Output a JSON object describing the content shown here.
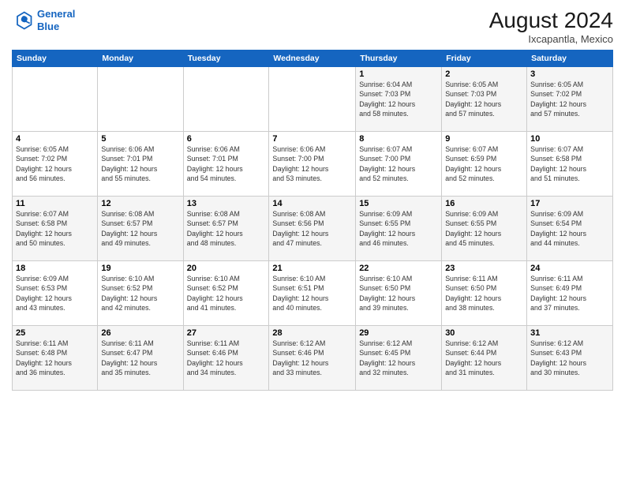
{
  "header": {
    "logo_line1": "General",
    "logo_line2": "Blue",
    "month_year": "August 2024",
    "location": "Ixcapantla, Mexico"
  },
  "days_of_week": [
    "Sunday",
    "Monday",
    "Tuesday",
    "Wednesday",
    "Thursday",
    "Friday",
    "Saturday"
  ],
  "weeks": [
    [
      {
        "day": "",
        "info": ""
      },
      {
        "day": "",
        "info": ""
      },
      {
        "day": "",
        "info": ""
      },
      {
        "day": "",
        "info": ""
      },
      {
        "day": "1",
        "info": "Sunrise: 6:04 AM\nSunset: 7:03 PM\nDaylight: 12 hours\nand 58 minutes."
      },
      {
        "day": "2",
        "info": "Sunrise: 6:05 AM\nSunset: 7:03 PM\nDaylight: 12 hours\nand 57 minutes."
      },
      {
        "day": "3",
        "info": "Sunrise: 6:05 AM\nSunset: 7:02 PM\nDaylight: 12 hours\nand 57 minutes."
      }
    ],
    [
      {
        "day": "4",
        "info": "Sunrise: 6:05 AM\nSunset: 7:02 PM\nDaylight: 12 hours\nand 56 minutes."
      },
      {
        "day": "5",
        "info": "Sunrise: 6:06 AM\nSunset: 7:01 PM\nDaylight: 12 hours\nand 55 minutes."
      },
      {
        "day": "6",
        "info": "Sunrise: 6:06 AM\nSunset: 7:01 PM\nDaylight: 12 hours\nand 54 minutes."
      },
      {
        "day": "7",
        "info": "Sunrise: 6:06 AM\nSunset: 7:00 PM\nDaylight: 12 hours\nand 53 minutes."
      },
      {
        "day": "8",
        "info": "Sunrise: 6:07 AM\nSunset: 7:00 PM\nDaylight: 12 hours\nand 52 minutes."
      },
      {
        "day": "9",
        "info": "Sunrise: 6:07 AM\nSunset: 6:59 PM\nDaylight: 12 hours\nand 52 minutes."
      },
      {
        "day": "10",
        "info": "Sunrise: 6:07 AM\nSunset: 6:58 PM\nDaylight: 12 hours\nand 51 minutes."
      }
    ],
    [
      {
        "day": "11",
        "info": "Sunrise: 6:07 AM\nSunset: 6:58 PM\nDaylight: 12 hours\nand 50 minutes."
      },
      {
        "day": "12",
        "info": "Sunrise: 6:08 AM\nSunset: 6:57 PM\nDaylight: 12 hours\nand 49 minutes."
      },
      {
        "day": "13",
        "info": "Sunrise: 6:08 AM\nSunset: 6:57 PM\nDaylight: 12 hours\nand 48 minutes."
      },
      {
        "day": "14",
        "info": "Sunrise: 6:08 AM\nSunset: 6:56 PM\nDaylight: 12 hours\nand 47 minutes."
      },
      {
        "day": "15",
        "info": "Sunrise: 6:09 AM\nSunset: 6:55 PM\nDaylight: 12 hours\nand 46 minutes."
      },
      {
        "day": "16",
        "info": "Sunrise: 6:09 AM\nSunset: 6:55 PM\nDaylight: 12 hours\nand 45 minutes."
      },
      {
        "day": "17",
        "info": "Sunrise: 6:09 AM\nSunset: 6:54 PM\nDaylight: 12 hours\nand 44 minutes."
      }
    ],
    [
      {
        "day": "18",
        "info": "Sunrise: 6:09 AM\nSunset: 6:53 PM\nDaylight: 12 hours\nand 43 minutes."
      },
      {
        "day": "19",
        "info": "Sunrise: 6:10 AM\nSunset: 6:52 PM\nDaylight: 12 hours\nand 42 minutes."
      },
      {
        "day": "20",
        "info": "Sunrise: 6:10 AM\nSunset: 6:52 PM\nDaylight: 12 hours\nand 41 minutes."
      },
      {
        "day": "21",
        "info": "Sunrise: 6:10 AM\nSunset: 6:51 PM\nDaylight: 12 hours\nand 40 minutes."
      },
      {
        "day": "22",
        "info": "Sunrise: 6:10 AM\nSunset: 6:50 PM\nDaylight: 12 hours\nand 39 minutes."
      },
      {
        "day": "23",
        "info": "Sunrise: 6:11 AM\nSunset: 6:50 PM\nDaylight: 12 hours\nand 38 minutes."
      },
      {
        "day": "24",
        "info": "Sunrise: 6:11 AM\nSunset: 6:49 PM\nDaylight: 12 hours\nand 37 minutes."
      }
    ],
    [
      {
        "day": "25",
        "info": "Sunrise: 6:11 AM\nSunset: 6:48 PM\nDaylight: 12 hours\nand 36 minutes."
      },
      {
        "day": "26",
        "info": "Sunrise: 6:11 AM\nSunset: 6:47 PM\nDaylight: 12 hours\nand 35 minutes."
      },
      {
        "day": "27",
        "info": "Sunrise: 6:11 AM\nSunset: 6:46 PM\nDaylight: 12 hours\nand 34 minutes."
      },
      {
        "day": "28",
        "info": "Sunrise: 6:12 AM\nSunset: 6:46 PM\nDaylight: 12 hours\nand 33 minutes."
      },
      {
        "day": "29",
        "info": "Sunrise: 6:12 AM\nSunset: 6:45 PM\nDaylight: 12 hours\nand 32 minutes."
      },
      {
        "day": "30",
        "info": "Sunrise: 6:12 AM\nSunset: 6:44 PM\nDaylight: 12 hours\nand 31 minutes."
      },
      {
        "day": "31",
        "info": "Sunrise: 6:12 AM\nSunset: 6:43 PM\nDaylight: 12 hours\nand 30 minutes."
      }
    ]
  ]
}
